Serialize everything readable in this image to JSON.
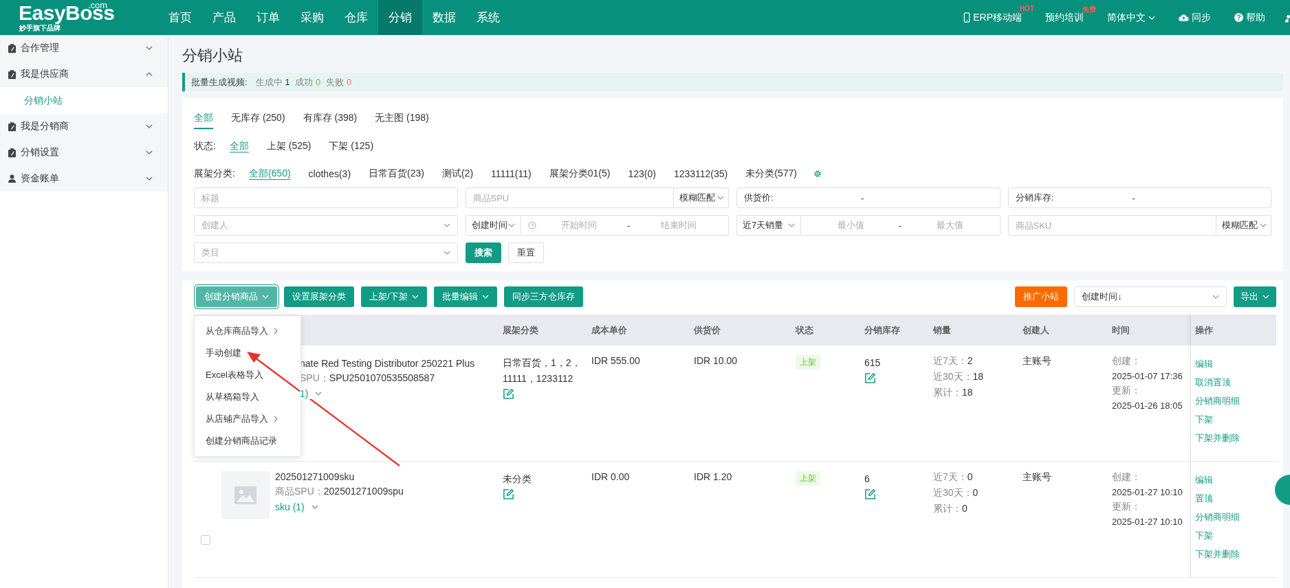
{
  "topbar": {
    "logo": {
      "name": "EasyBoss",
      "suffix": ".com",
      "tagline": "妙手旗下品牌"
    },
    "nav": [
      {
        "label": "首页",
        "selected": false
      },
      {
        "label": "产品",
        "selected": false
      },
      {
        "label": "订单",
        "selected": false
      },
      {
        "label": "采购",
        "selected": false
      },
      {
        "label": "仓库",
        "selected": false
      },
      {
        "label": "分销",
        "selected": true
      },
      {
        "label": "数据",
        "selected": false
      },
      {
        "label": "系统",
        "selected": false
      }
    ],
    "actions": [
      {
        "kind": "phone",
        "label": "ERP移动端",
        "badge": "HOT"
      },
      {
        "kind": "plain",
        "label": "预约培训",
        "badge": "免费"
      },
      {
        "kind": "dropdown",
        "label": "简体中文"
      },
      {
        "kind": "cloud",
        "label": "同步"
      },
      {
        "kind": "help",
        "label": "帮助"
      },
      {
        "kind": "user"
      }
    ]
  },
  "sidebar": {
    "items": [
      {
        "kind": "folder",
        "label": "合作管理",
        "expanded": false
      },
      {
        "kind": "folder",
        "label": "我是供应商",
        "expanded": true,
        "children": [
          {
            "label": "分销小站",
            "selected": true
          }
        ]
      },
      {
        "kind": "folder",
        "label": "我是分销商",
        "expanded": false
      },
      {
        "kind": "folder",
        "label": "分销设置",
        "expanded": false
      },
      {
        "kind": "account",
        "label": "资金账单",
        "expanded": false
      }
    ]
  },
  "page": {
    "title": "分销小站"
  },
  "notice": {
    "label": "批量生成视频:",
    "items": [
      {
        "label": "生成中",
        "count": "1",
        "color": "#333333"
      },
      {
        "label": "成功",
        "count": "0",
        "color": "#67c23a"
      },
      {
        "label": "失败",
        "count": "0",
        "color": "#f56c6c"
      }
    ]
  },
  "filters": {
    "tabs": [
      {
        "label": "全部",
        "selected": true
      },
      {
        "label": "无库存 (250)",
        "selected": false
      },
      {
        "label": "有库存 (398)",
        "selected": false
      },
      {
        "label": "无主图 (198)",
        "selected": false
      }
    ],
    "status": {
      "label": "状态:",
      "options": [
        {
          "label": "全部",
          "selected": true
        },
        {
          "label": "上架 (525)",
          "selected": false
        },
        {
          "label": "下架 (125)",
          "selected": false
        }
      ]
    },
    "shelf": {
      "label": "展架分类:",
      "options": [
        {
          "label": "全部(650)",
          "selected": true
        },
        {
          "label": "clothes(3)",
          "selected": false
        },
        {
          "label": "日常百货(23)",
          "selected": false
        },
        {
          "label": "测试(2)",
          "selected": false
        },
        {
          "label": "11111(11)",
          "selected": false
        },
        {
          "label": "展架分类01(5)",
          "selected": false
        },
        {
          "label": "123(0)",
          "selected": false
        },
        {
          "label": "1233112(35)",
          "selected": false
        },
        {
          "label": "未分类(577)",
          "selected": false
        }
      ]
    },
    "fields": [
      {
        "kind": "text",
        "placeholder": "标题"
      },
      {
        "kind": "text_match",
        "placeholder": "商品SPU",
        "match": "模糊匹配"
      },
      {
        "kind": "range",
        "label": "供货价:",
        "separator": "-"
      },
      {
        "kind": "range",
        "label": "分销库存:",
        "separator": "-"
      },
      {
        "kind": "select",
        "placeholder": "创建人"
      },
      {
        "kind": "date_range",
        "select": "创建时间",
        "start": "开始时间",
        "separator": "-",
        "end": "结束时间"
      },
      {
        "kind": "num_range",
        "select": "近7天销量",
        "start": "最小值",
        "separator": "-",
        "end": "最大值"
      },
      {
        "kind": "text_match",
        "placeholder": "商品SKU",
        "match": "模糊匹配"
      },
      {
        "kind": "select",
        "placeholder": "类目"
      }
    ],
    "buttons": [
      {
        "label": "搜索",
        "primary": true
      },
      {
        "label": "重置",
        "primary": false
      }
    ]
  },
  "toolbar": {
    "buttons": [
      {
        "label": "创建分销商品",
        "caret": true,
        "open": true
      },
      {
        "label": "设置展架分类",
        "caret": false,
        "open": false
      },
      {
        "label": "上架/下架",
        "caret": true,
        "open": false
      },
      {
        "label": "批量编辑",
        "caret": true,
        "open": false
      },
      {
        "label": "同步三方仓库存",
        "caret": false,
        "open": false
      }
    ],
    "promote": "推广小站",
    "sort": "创建时间↓",
    "export": "导出"
  },
  "menu": {
    "items": [
      {
        "label": "从仓库商品导入",
        "submenu": true
      },
      {
        "label": "手动创建",
        "submenu": false
      },
      {
        "label": "Excel表格导入",
        "submenu": false
      },
      {
        "label": "从草稿箱导入",
        "submenu": false
      },
      {
        "label": "从店铺产品导入",
        "submenu": true
      },
      {
        "label": "创建分销商品记录",
        "submenu": false
      }
    ]
  },
  "table": {
    "columns": [
      "展架分类",
      "成本单价",
      "供货价",
      "状态",
      "分销库存",
      "销量",
      "创建人",
      "时间",
      "操作"
    ],
    "rows": [
      {
        "covered": true,
        "title": "nate Red Testing Distributor 250221 Plus",
        "spu_label": "SPU：",
        "spu": "SPU2501070535508587",
        "sku": "1)",
        "category": "日常百货，1，2，11111，1233112",
        "cost": "IDR 555.00",
        "supply": "IDR 10.00",
        "status": "上架",
        "stock": "615",
        "sales": [
          {
            "label": "近7天：",
            "value": "2"
          },
          {
            "label": "近30天：",
            "value": "18"
          },
          {
            "label": "累计：",
            "value": "18"
          }
        ],
        "creator": "主账号",
        "time": [
          {
            "label": "创建：",
            "value": "2025-01-07 17:36"
          },
          {
            "label": "更新：",
            "value": "2025-01-26 18:05"
          }
        ],
        "actions": [
          "编辑",
          "取消置顶",
          "分销商明细",
          "下架",
          "下架并删除"
        ]
      },
      {
        "covered": false,
        "checked": false,
        "title": "202501271009sku",
        "spu_label": "商品SPU：",
        "spu": "202501271009spu",
        "sku": "sku (1)",
        "category": "未分类",
        "cost": "IDR 0.00",
        "supply": "IDR 1.20",
        "status": "上架",
        "stock": "6",
        "sales": [
          {
            "label": "近7天：",
            "value": "0"
          },
          {
            "label": "近30天：",
            "value": "0"
          },
          {
            "label": "累计：",
            "value": "0"
          }
        ],
        "creator": "主账号",
        "time": [
          {
            "label": "创建：",
            "value": "2025-01-27 10:10"
          },
          {
            "label": "更新：",
            "value": "2025-01-27 10:10"
          }
        ],
        "actions": [
          "编辑",
          "置顶",
          "分销商明细",
          "下架",
          "下架并删除"
        ]
      }
    ]
  }
}
